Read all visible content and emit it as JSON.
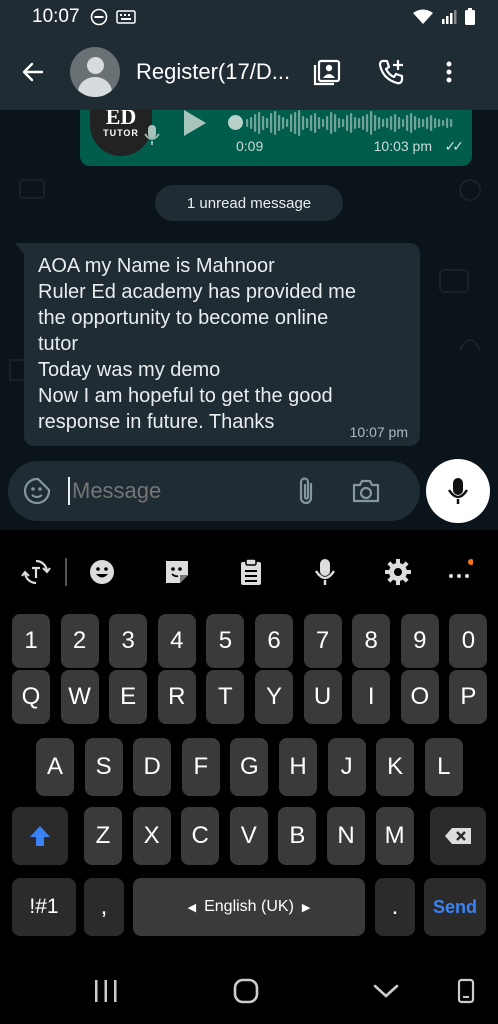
{
  "status_bar": {
    "time": "10:07",
    "icons": [
      "do-not-disturb-icon",
      "keyboard-icon",
      "wifi-icon",
      "signal-icon",
      "battery-icon"
    ]
  },
  "header": {
    "title": "Register(17/D...",
    "icons": [
      "back-arrow-icon",
      "contact-card-icon",
      "add-call-icon",
      "more-vert-icon"
    ]
  },
  "voice_message": {
    "thumbnail_text_main": "ED",
    "thumbnail_text_sub": "TUTOR",
    "duration": "0:09",
    "time": "10:03 pm",
    "ticks": "✓✓"
  },
  "unread_banner": "1 unread message",
  "message": {
    "lines": [
      "AOA my Name is Mahnoor",
      "Ruler Ed academy has provided me",
      "the opportunity to become online",
      "tutor",
      "Today was my demo",
      "Now I am hopeful to get the good",
      "response in future. Thanks"
    ],
    "time": "10:07 pm"
  },
  "compose": {
    "placeholder": "Message",
    "icons": [
      "sticker-emoji-icon",
      "attach-icon",
      "camera-icon",
      "mic-icon"
    ]
  },
  "keyboard": {
    "toolbar": [
      "translate-icon",
      "emoji-icon",
      "sticker-icon",
      "clipboard-icon",
      "voice-input-icon",
      "settings-icon",
      "more-icon"
    ],
    "number_row": [
      "1",
      "2",
      "3",
      "4",
      "5",
      "6",
      "7",
      "8",
      "9",
      "0"
    ],
    "row1": [
      "Q",
      "W",
      "E",
      "R",
      "T",
      "Y",
      "U",
      "I",
      "O",
      "P"
    ],
    "row2": [
      "A",
      "S",
      "D",
      "F",
      "G",
      "H",
      "J",
      "K",
      "L"
    ],
    "row3": [
      "Z",
      "X",
      "C",
      "V",
      "B",
      "N",
      "M"
    ],
    "symbols_label": "!#1",
    "comma": ",",
    "space_label": "English (UK)",
    "period": ".",
    "send_label": "Send"
  },
  "colors": {
    "header_bg": "#1f2c33",
    "chat_bg": "#0b141a",
    "outgoing_bubble": "#005c4b",
    "accent_send": "#3b82f6",
    "notification_dot": "#f97316"
  }
}
